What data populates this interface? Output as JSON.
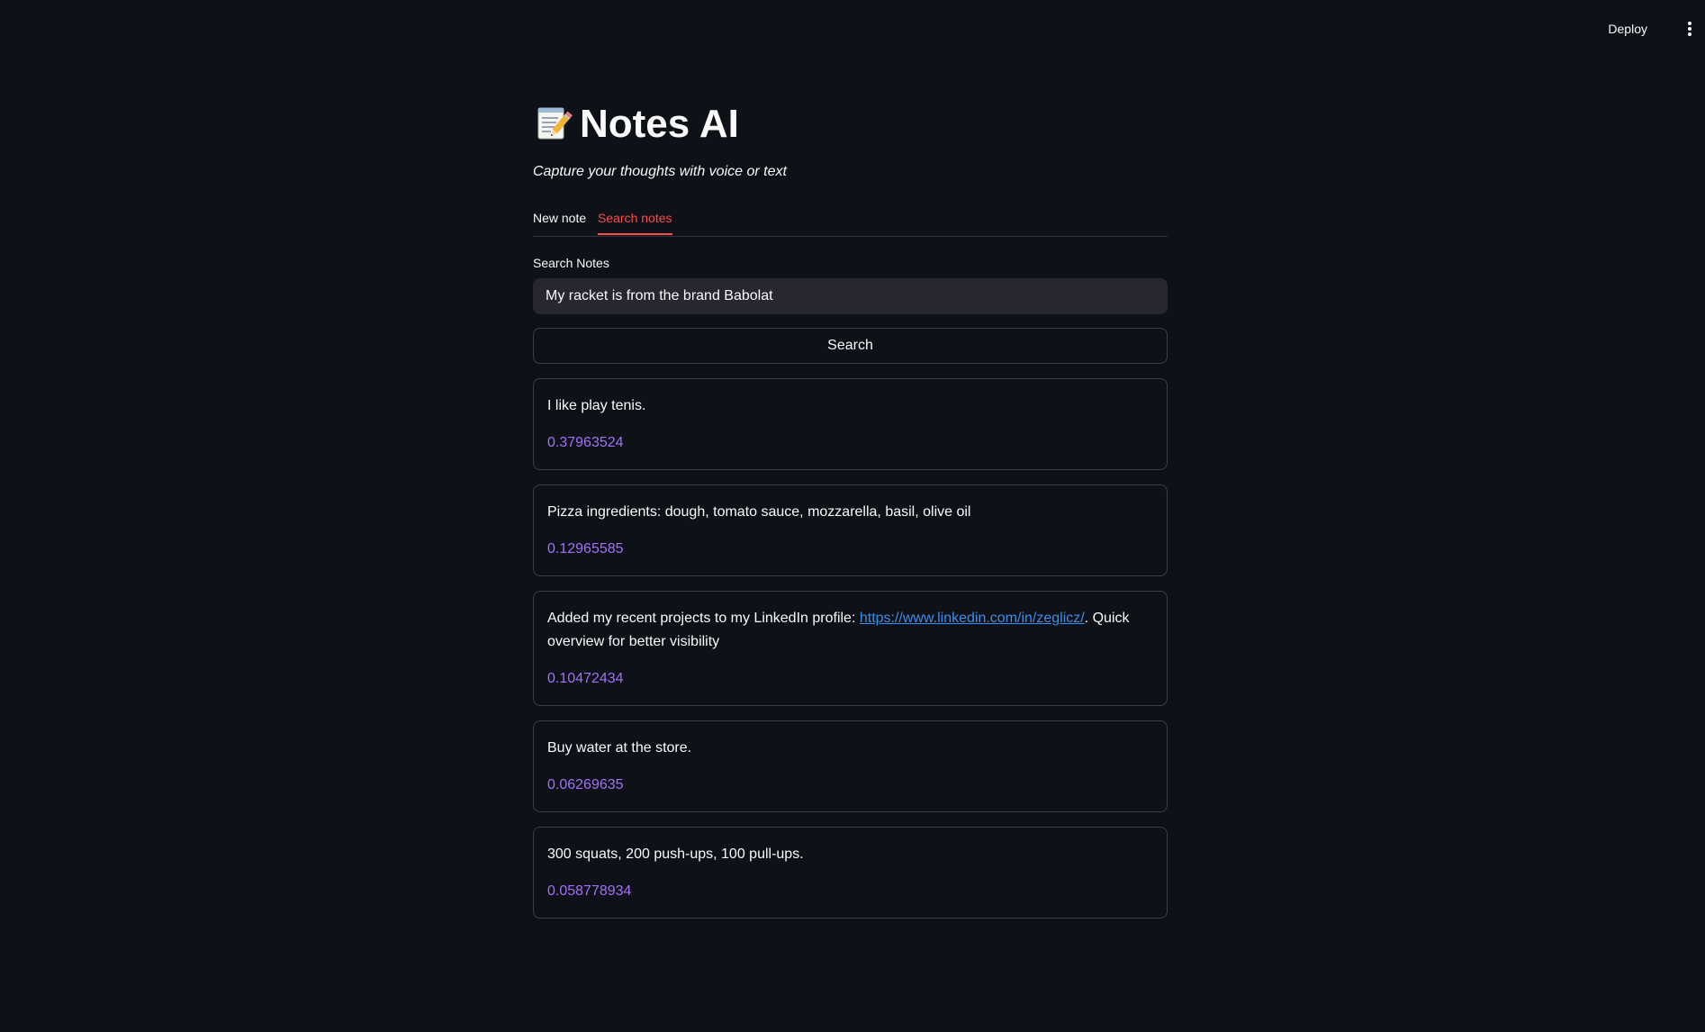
{
  "header": {
    "deploy_label": "Deploy",
    "menu_icon": "kebab-menu-icon"
  },
  "app": {
    "title_icon": "memo-icon",
    "title": "Notes AI",
    "subtitle": "Capture your thoughts with voice or text"
  },
  "tabs": [
    {
      "label": "New note",
      "active": false
    },
    {
      "label": "Search notes",
      "active": true
    }
  ],
  "search": {
    "label": "Search Notes",
    "value": "My racket is from the brand Babolat",
    "button_label": "Search"
  },
  "results": [
    {
      "text": "I like play tenis.",
      "score": "0.37963524"
    },
    {
      "text": "Pizza ingredients: dough, tomato sauce, mozzarella, basil, olive oil",
      "score": "0.12965585"
    },
    {
      "text_before": "Added my recent projects to my LinkedIn profile: ",
      "link": "https://www.linkedin.com/in/zeglicz/",
      "text_after": ". Quick overview for better visibility",
      "score": "0.10472434"
    },
    {
      "text": "Buy water at the store.",
      "score": "0.06269635"
    },
    {
      "text": "300 squats, 200 push-ups, 100 pull-ups.",
      "score": "0.058778934"
    }
  ],
  "colors": {
    "background": "#0e1117",
    "accent": "#ff4b4b",
    "score": "#a371f7",
    "link": "#3b8eea"
  }
}
